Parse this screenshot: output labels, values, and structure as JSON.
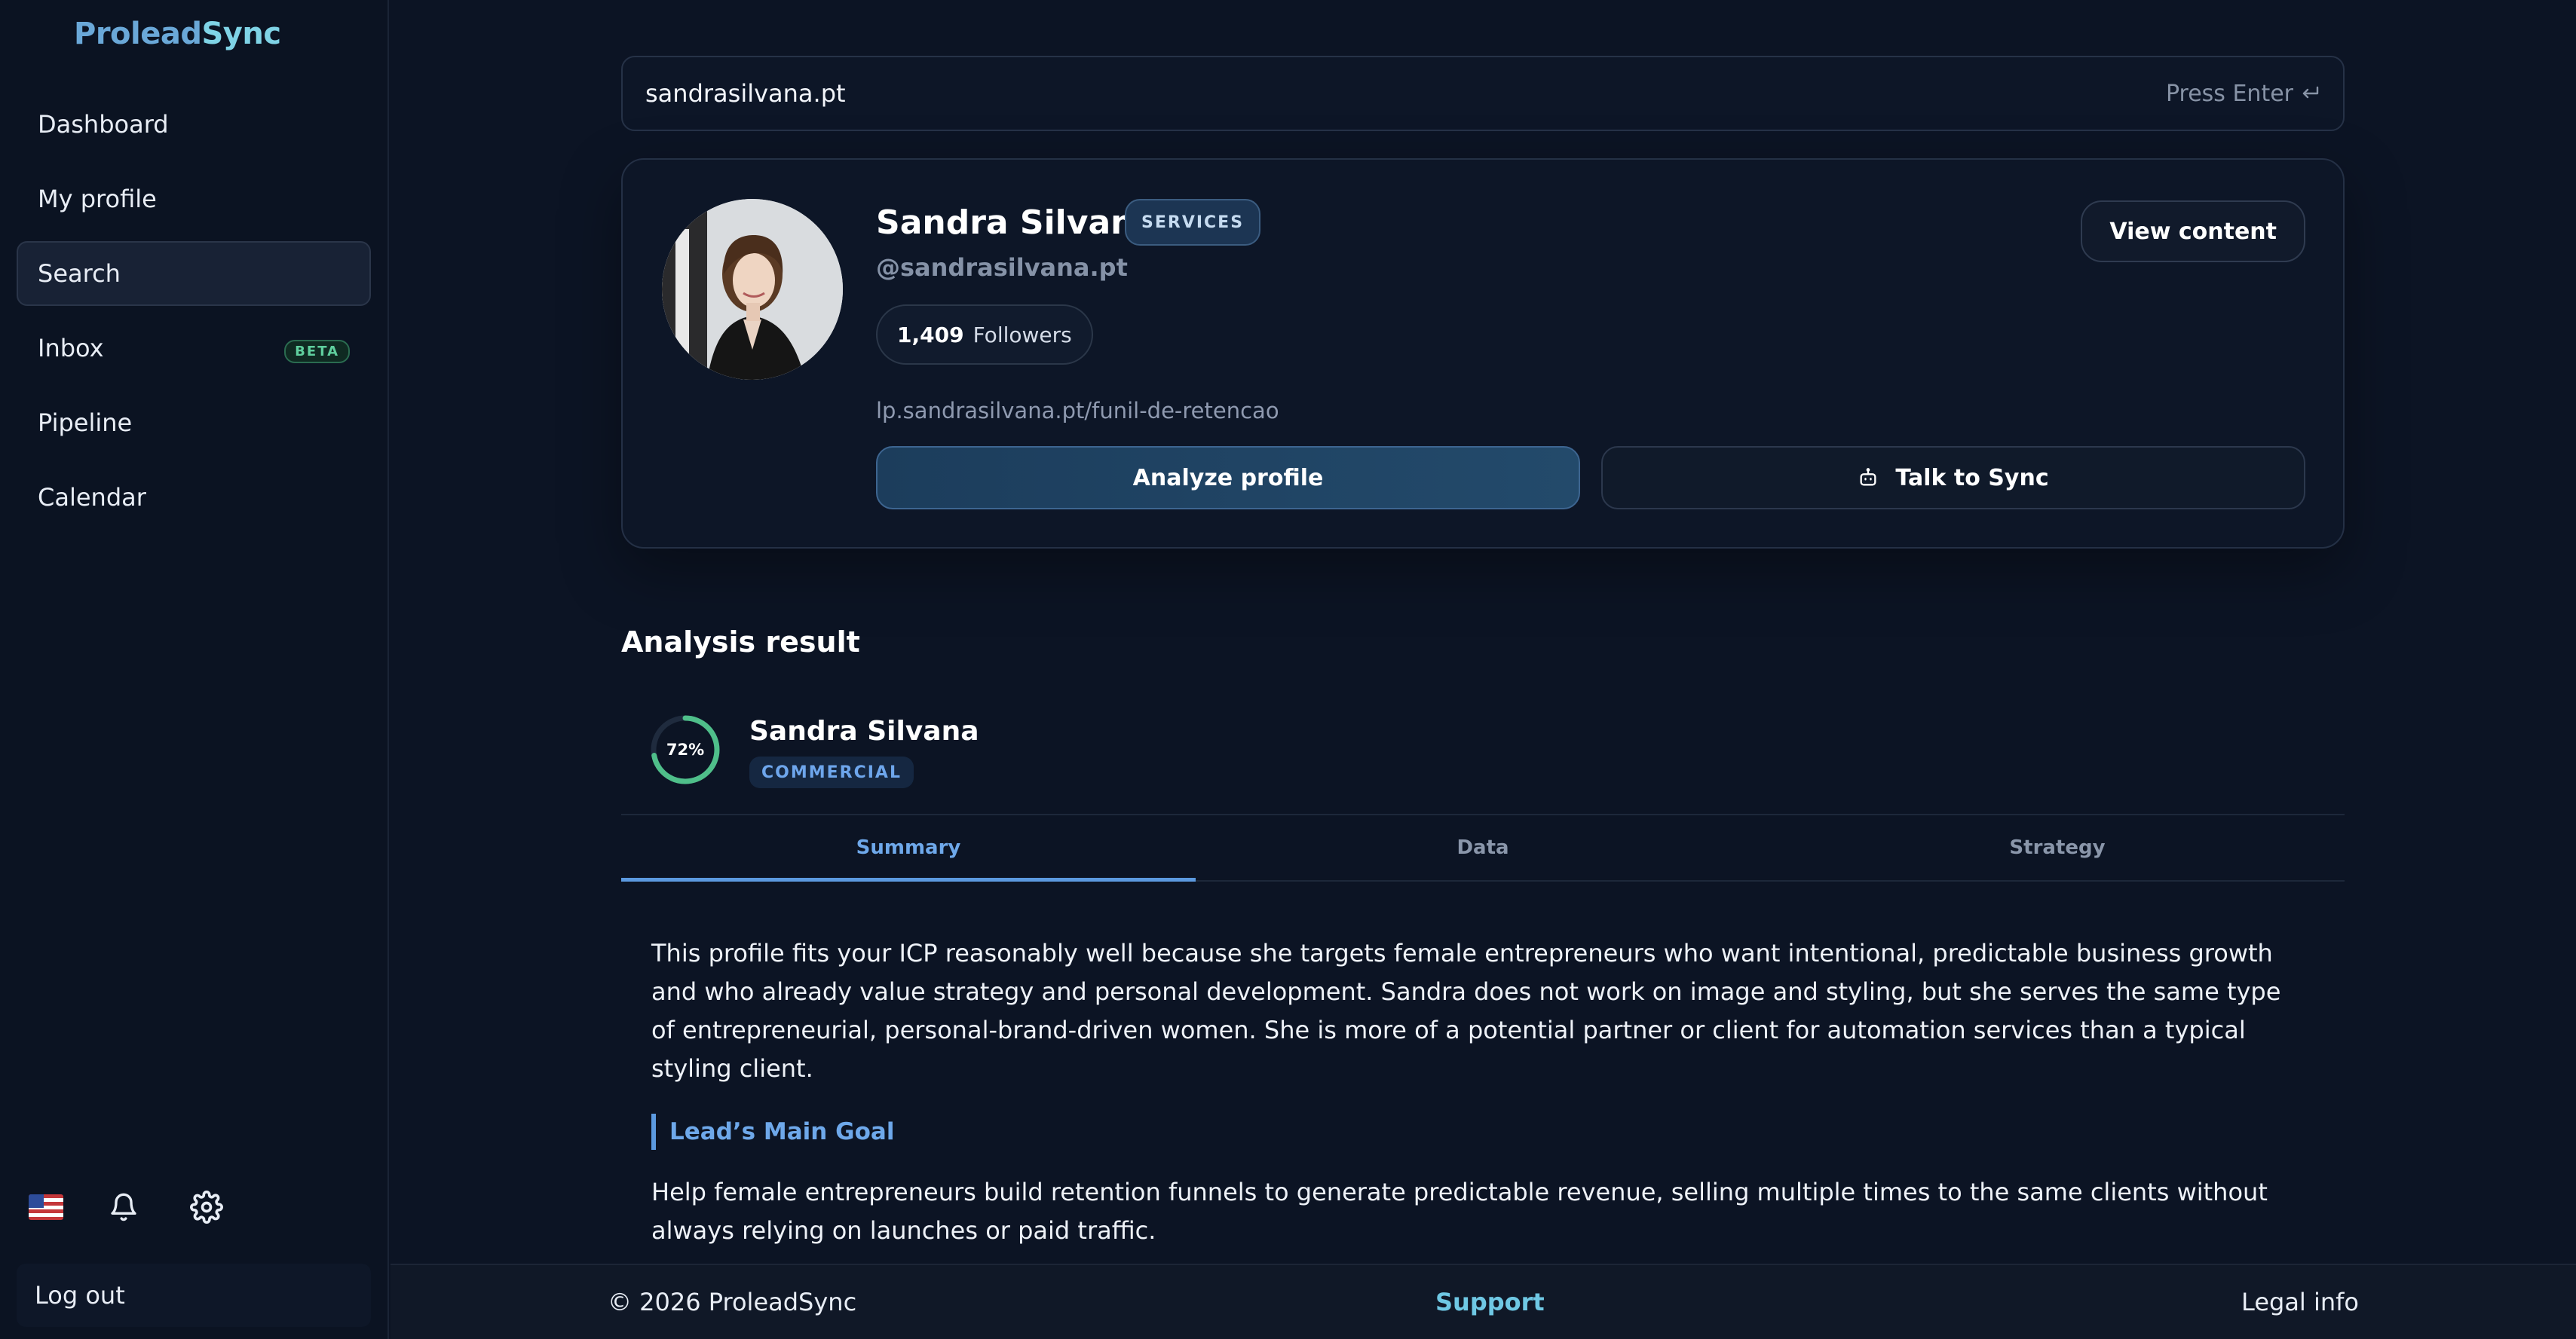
{
  "brand": {
    "part1": "Prolead",
    "part2": "Sync"
  },
  "sidebar": {
    "items": [
      {
        "label": "Dashboard"
      },
      {
        "label": "My profile"
      },
      {
        "label": "Search",
        "active": true
      },
      {
        "label": "Inbox",
        "badge": "BETA"
      },
      {
        "label": "Pipeline"
      },
      {
        "label": "Calendar"
      }
    ],
    "icons": [
      "us-flag-icon",
      "bell-icon",
      "gear-icon"
    ],
    "logout_label": "Log out"
  },
  "search": {
    "value": "sandrasilvana.pt",
    "hint": "Press Enter",
    "hint_icon": "enter-return-icon"
  },
  "profile": {
    "name": "Sandra Silvana",
    "badge": "SERVICES",
    "handle": "@sandrasilvana.pt",
    "followers_count": "1,409",
    "followers_label": "Followers",
    "link": "lp.sandrasilvana.pt/funil-de-retencao",
    "view_button": "View content",
    "analyze_button": "Analyze profile",
    "talk_button": "Talk to Sync",
    "talk_icon": "robot-icon"
  },
  "analysis": {
    "title": "Analysis result",
    "score_text": "72%",
    "score_value": 0.72,
    "name": "Sandra Silvana",
    "badge": "COMMERCIAL",
    "tabs": [
      {
        "label": "Summary",
        "active": true
      },
      {
        "label": "Data"
      },
      {
        "label": "Strategy"
      }
    ],
    "summary": "This profile fits your ICP reasonably well because she targets female entrepreneurs who want intentional, predictable business growth and who already value strategy and personal development. Sandra does not work on image and styling, but she serves the same type of entrepreneurial, personal-brand-driven women. She is more of a potential partner or client for automation services than a typical styling client.",
    "goal_title": "Lead’s Main Goal",
    "goal_text": "Help female entrepreneurs build retention funnels to generate predictable revenue, selling multiple times to the same clients without always relying on launches or paid traffic."
  },
  "footer": {
    "copyright": "© 2026 ProleadSync",
    "support": "Support",
    "legal": "Legal info"
  },
  "colors": {
    "background": "#0c1424",
    "accent": "#5c9ae0",
    "success": "#4fbf8a",
    "brand": "#6aa8d8"
  }
}
